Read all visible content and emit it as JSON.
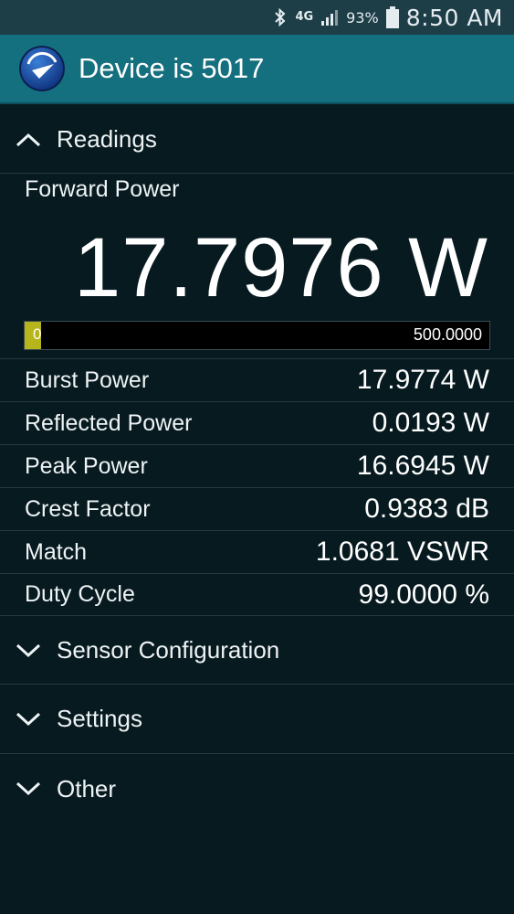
{
  "status_bar": {
    "network": "4G",
    "battery": "93%",
    "time": "8:50 AM"
  },
  "app_bar": {
    "title": "Device is 5017"
  },
  "readings": {
    "header": "Readings",
    "forward_power": {
      "label": "Forward Power",
      "value": "17.7976 W",
      "bar_min": "0",
      "bar_max": "500.0000",
      "bar_fraction": 0.0356
    },
    "rows": [
      {
        "label": "Burst Power",
        "value": "17.9774 W"
      },
      {
        "label": "Reflected Power",
        "value": "0.0193 W"
      },
      {
        "label": "Peak Power",
        "value": "16.6945 W"
      },
      {
        "label": "Crest Factor",
        "value": "0.9383 dB"
      },
      {
        "label": "Match",
        "value": "1.0681 VSWR"
      },
      {
        "label": "Duty Cycle",
        "value": "99.0000 %"
      }
    ]
  },
  "sections": [
    {
      "label": "Sensor Configuration"
    },
    {
      "label": "Settings"
    },
    {
      "label": "Other"
    }
  ],
  "colors": {
    "background": "#071a20",
    "app_bar": "#146f7f",
    "status_bar": "#1d3d47",
    "bar_fill": "#b6b61c"
  }
}
